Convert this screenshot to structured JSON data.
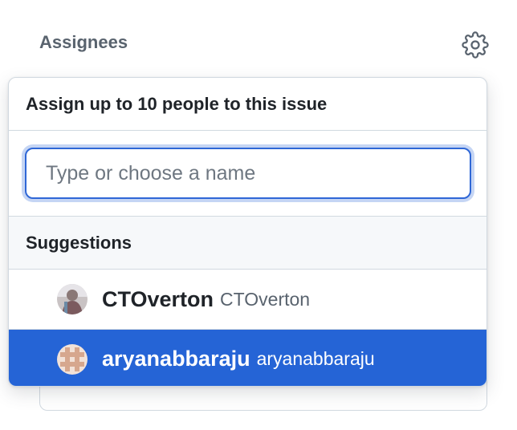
{
  "sidebar": {
    "heading": "Assignees",
    "settings_icon": "gear-icon"
  },
  "popover": {
    "title": "Assign up to 10 people to this issue",
    "filter": {
      "value": "",
      "placeholder": "Type or choose a name"
    },
    "section_label": "Suggestions",
    "suggestions": [
      {
        "login": "CTOverton",
        "name": "CTOverton",
        "selected": false
      },
      {
        "login": "aryanabbaraju",
        "name": "aryanabbaraju",
        "selected": true
      }
    ]
  },
  "colors": {
    "accent": "#2564d6",
    "focus_ring": "#2f67d6",
    "muted_text": "#59636e",
    "border": "#d1d9e0",
    "section_bg": "#f6f8fa"
  }
}
